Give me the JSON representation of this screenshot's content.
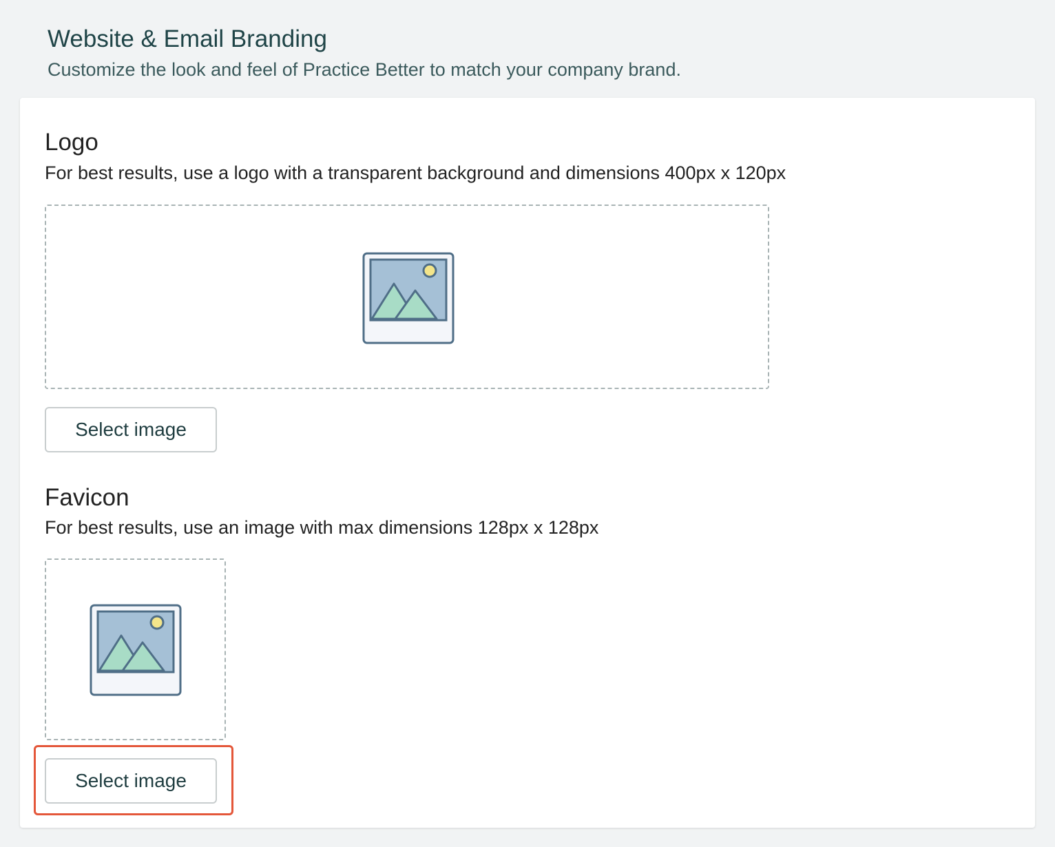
{
  "header": {
    "title": "Website & Email Branding",
    "subtitle": "Customize the look and feel of Practice Better to match your company brand."
  },
  "logo": {
    "title": "Logo",
    "description": "For best results, use a logo with a transparent background and dimensions 400px x 120px",
    "button_label": "Select image",
    "icon": "image-placeholder-icon"
  },
  "favicon": {
    "title": "Favicon",
    "description": "For best results, use an image with max dimensions 128px x 128px",
    "button_label": "Select image",
    "icon": "image-placeholder-icon"
  },
  "colors": {
    "background": "#f1f3f4",
    "title_text": "#1f4447",
    "highlight": "#e4573a",
    "icon_frame": "#4f6e87",
    "icon_sky": "#a5c0d6",
    "icon_mountain": "#a8dcc6",
    "icon_sun": "#f3e58a"
  }
}
